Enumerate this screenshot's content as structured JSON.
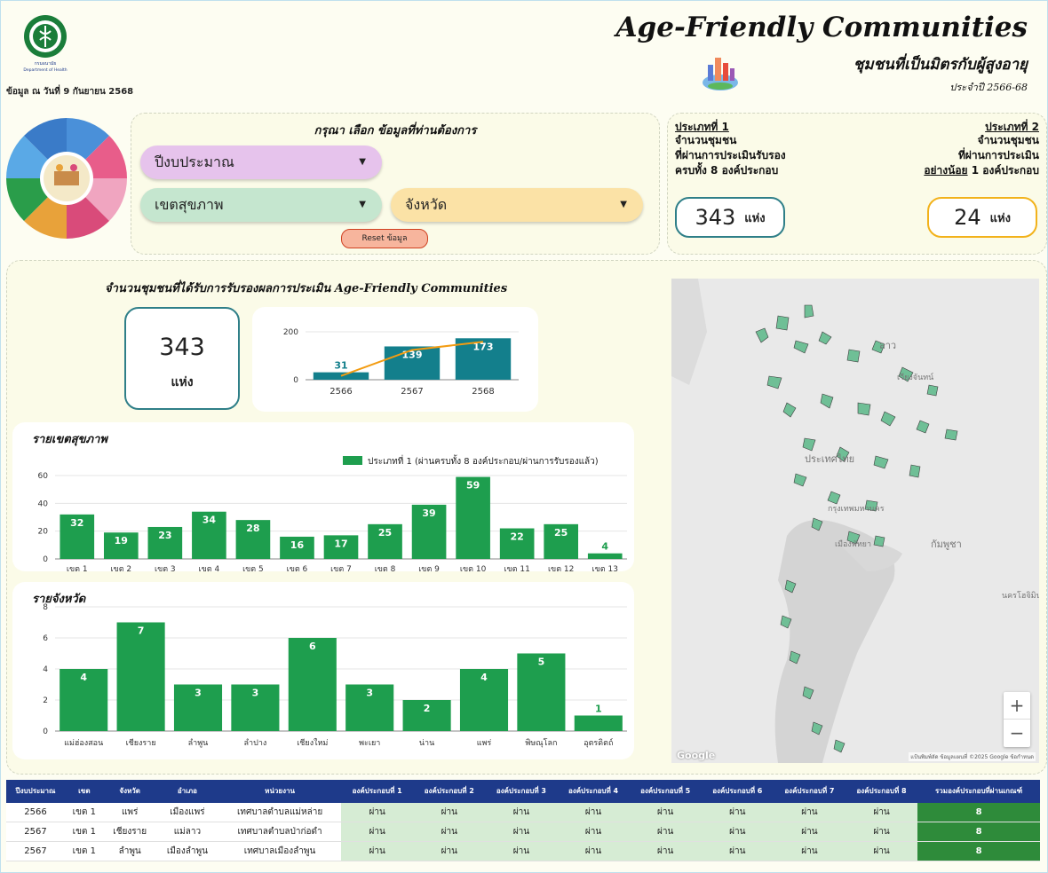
{
  "header": {
    "logo_caption_th": "กรมอนามัย",
    "logo_caption_en": "Department of Health",
    "date_line": "ข้อมูล ณ วันที่ 9 กันยายน 2568",
    "title": "Age-Friendly Communities",
    "subtitle": "ชุมชนที่เป็นมิตรกับผู้สูงอายุ",
    "year_line": "ประจำปี 2566-68"
  },
  "filters": {
    "title": "กรุณา เลือก ข้อมูลที่ท่านต้องการ",
    "year_label": "ปีงบประมาณ",
    "region_label": "เขตสุขภาพ",
    "province_label": "จังหวัด",
    "reset_label": "Reset ข้อมูล"
  },
  "types": {
    "type1": {
      "head": "ประเภทที่ 1",
      "line1": "จำนวนชุมชน",
      "line2": "ที่ผ่านการประเมินรับรอง",
      "line3": "ครบทั้ง 8 องค์ประกอบ",
      "value": "343",
      "unit": "แห่ง"
    },
    "type2": {
      "head": "ประเภทที่ 2",
      "line1": "จำนวนชุมชน",
      "line2": "ที่ผ่านการประเมิน",
      "line3_underline": "อย่างน้อย",
      "line3_rest": " 1 องค์ประกอบ",
      "value": "24",
      "unit": "แห่ง"
    }
  },
  "main": {
    "title": "จำนวนชุมชนที่ได้รับการรับรองผลการประเมิน Age-Friendly Communities",
    "total_value": "343",
    "total_unit": "แห่ง",
    "region_title": "รายเขตสุขภาพ",
    "province_title": "รายจังหวัด",
    "legend_label": "ประเภทที่ 1 (ผ่านครบทั้ง 8 องค์ประกอบ/ผ่านการรับรองแล้ว)"
  },
  "colors": {
    "teal": "#137f8c",
    "orange": "#f39c12",
    "green": "#1e9e4e",
    "header_blue": "#1e3a8a"
  },
  "chart_data": [
    {
      "type": "bar",
      "categories": [
        "2566",
        "2567",
        "2568"
      ],
      "values": [
        31,
        139,
        173
      ],
      "ylim": [
        0,
        200
      ],
      "yticks": [
        0,
        200
      ],
      "overlay": "line"
    },
    {
      "type": "bar",
      "categories": [
        "เขต 1",
        "เขต 2",
        "เขต 3",
        "เขต 4",
        "เขต 5",
        "เขต 6",
        "เขต 7",
        "เขต 8",
        "เขต 9",
        "เขต 10",
        "เขต 11",
        "เขต 12",
        "เขต 13"
      ],
      "values": [
        32,
        19,
        23,
        34,
        28,
        16,
        17,
        25,
        39,
        59,
        22,
        25,
        4
      ],
      "ylim": [
        0,
        60
      ],
      "yticks": [
        0,
        20,
        40,
        60
      ],
      "legend": "top-right"
    },
    {
      "type": "bar",
      "categories": [
        "แม่ฮ่องสอน",
        "เชียงราย",
        "ลำพูน",
        "ลำปาง",
        "เชียงใหม่",
        "พะเยา",
        "น่าน",
        "แพร่",
        "พิษณุโลก",
        "อุตรดิตถ์"
      ],
      "values": [
        4,
        7,
        3,
        3,
        6,
        3,
        2,
        4,
        5,
        1
      ],
      "ylim": [
        0,
        8
      ],
      "yticks": [
        0,
        2,
        4,
        6,
        8
      ]
    }
  ],
  "map": {
    "labels": {
      "laos": "ลาว",
      "vientiane": "เวียงจันทน์",
      "thailand": "ประเทศไทย",
      "bangkok": "กรุงเทพมหานคร",
      "cambodia": "กัมพูชา",
      "pattaya": "เมืองพัทยา",
      "hochiminh": "นครโฮจิมินห์"
    },
    "zoom_in": "+",
    "zoom_out": "−",
    "attribution": "แป้นพิมพ์ลัด  ข้อมูลแผนที่ ©2025 Google  ข้อกำหนด",
    "google": "Google"
  },
  "table": {
    "headers": [
      "ปีงบประมาณ",
      "เขต",
      "จังหวัด",
      "อำเภอ",
      "หน่วยงาน",
      "องค์ประกอบที่ 1",
      "องค์ประกอบที่ 2",
      "องค์ประกอบที่ 3",
      "องค์ประกอบที่ 4",
      "องค์ประกอบที่ 5",
      "องค์ประกอบที่ 6",
      "องค์ประกอบที่ 7",
      "องค์ประกอบที่ 8",
      "รวมองค์ประกอบที่ผ่านเกณฑ์"
    ],
    "rows": [
      [
        "2566",
        "เขต 1",
        "แพร่",
        "เมืองแพร่",
        "เทศบาลตำบลแม่หล่าย",
        "ผ่าน",
        "ผ่าน",
        "ผ่าน",
        "ผ่าน",
        "ผ่าน",
        "ผ่าน",
        "ผ่าน",
        "ผ่าน",
        "8"
      ],
      [
        "2567",
        "เขต 1",
        "เชียงราย",
        "แม่ลาว",
        "เทศบาลตำบลป่าก่อดำ",
        "ผ่าน",
        "ผ่าน",
        "ผ่าน",
        "ผ่าน",
        "ผ่าน",
        "ผ่าน",
        "ผ่าน",
        "ผ่าน",
        "8"
      ],
      [
        "2567",
        "เขต 1",
        "ลำพูน",
        "เมืองลำพูน",
        "เทศบาลเมืองลำพูน",
        "ผ่าน",
        "ผ่าน",
        "ผ่าน",
        "ผ่าน",
        "ผ่าน",
        "ผ่าน",
        "ผ่าน",
        "ผ่าน",
        "8"
      ]
    ]
  }
}
